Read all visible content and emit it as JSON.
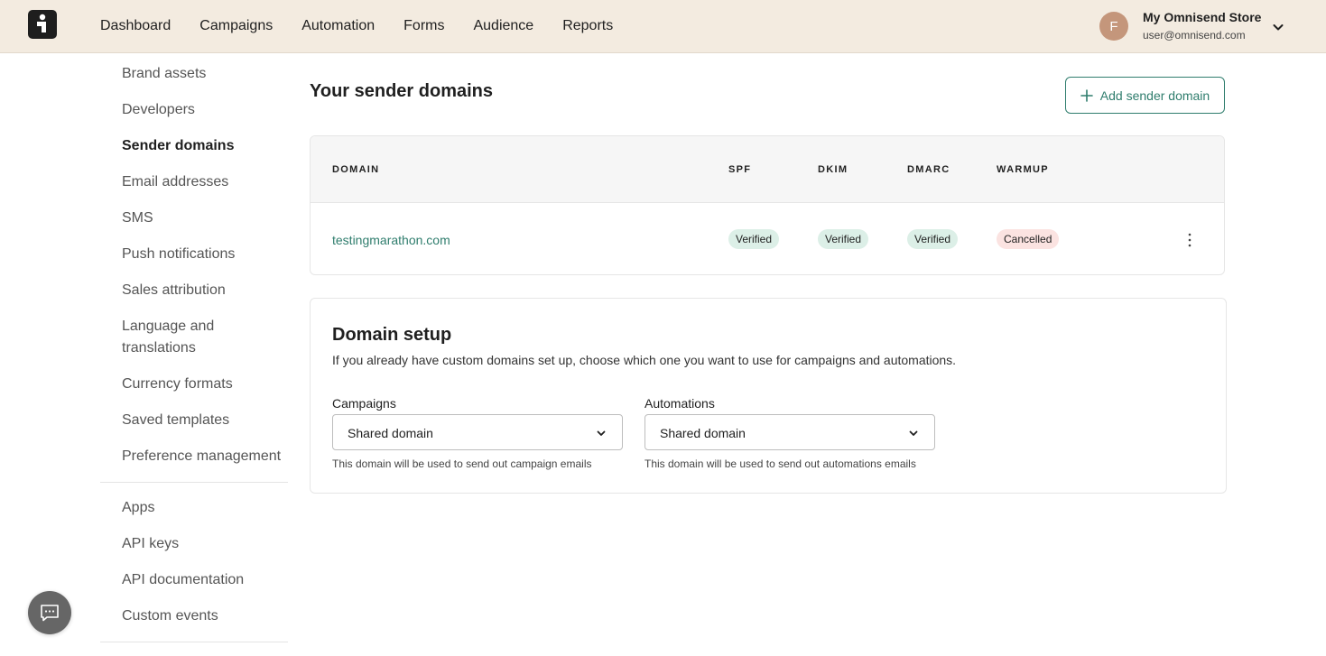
{
  "nav": {
    "items": [
      "Dashboard",
      "Campaigns",
      "Automation",
      "Forms",
      "Audience",
      "Reports"
    ]
  },
  "account": {
    "avatar_initial": "F",
    "store_name": "My Omnisend Store",
    "email": "user@omnisend.com"
  },
  "sidebar": {
    "items": [
      "Brand assets",
      "Developers",
      "Sender domains",
      "Email addresses",
      "SMS",
      "Push notifications",
      "Sales attribution",
      "Language and translations",
      "Currency formats",
      "Saved templates",
      "Preference management",
      "Apps",
      "API keys",
      "API documentation",
      "Custom events"
    ],
    "active": "Sender domains"
  },
  "sender_domains": {
    "title": "Your sender domains",
    "add_button": "Add sender domain",
    "columns": [
      "DOMAIN",
      "SPF",
      "DKIM",
      "DMARC",
      "WARMUP"
    ],
    "rows": [
      {
        "domain": "testingmarathon.com",
        "spf": "Verified",
        "dkim": "Verified",
        "dmarc": "Verified",
        "warmup": "Cancelled"
      }
    ]
  },
  "domain_setup": {
    "title": "Domain setup",
    "description": "If you already have custom domains set up, choose which one you want to use for campaigns and automations.",
    "campaigns": {
      "label": "Campaigns",
      "value": "Shared domain",
      "hint": "This domain will be used to send out campaign emails"
    },
    "automations": {
      "label": "Automations",
      "value": "Shared domain",
      "hint": "This domain will be used to send out automations emails"
    }
  },
  "colors": {
    "topbar_bg": "#f3ebe0",
    "accent": "#2f7d6d",
    "verified_bg": "#dcefe7",
    "cancelled_bg": "#fbe3e1",
    "avatar_bg": "#c4967b"
  },
  "icons": {
    "logo": "omnisend-logo-icon",
    "account_chevron": "chevron-down-icon",
    "add": "plus-icon",
    "row_menu": "kebab-menu-icon",
    "select_chevron": "chevron-down-icon",
    "chat": "chat-bubble-icon"
  }
}
